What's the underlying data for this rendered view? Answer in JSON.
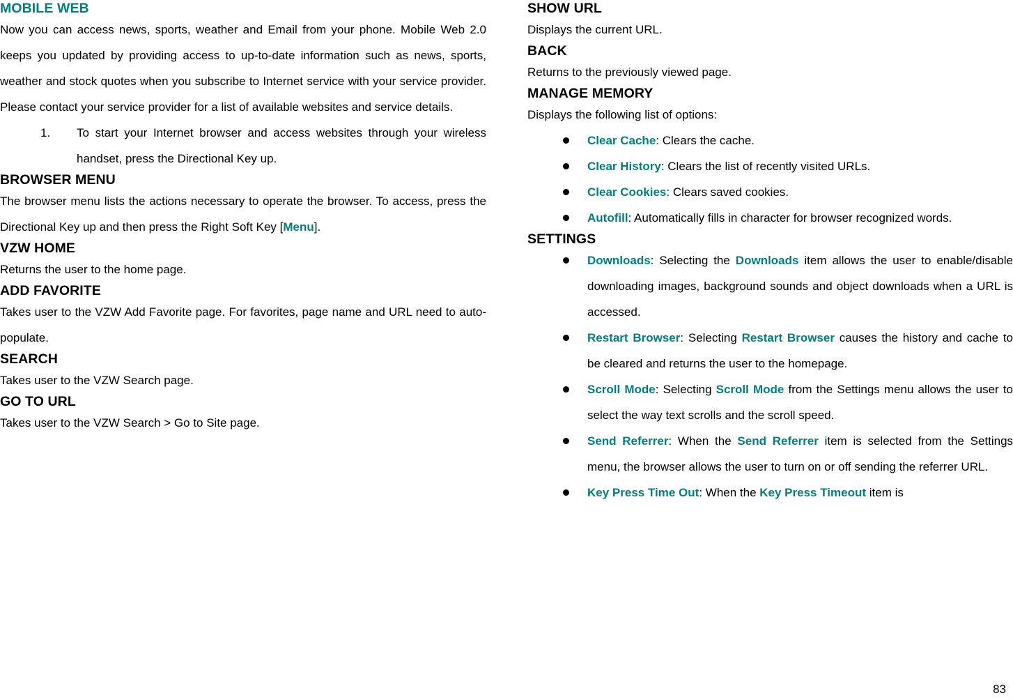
{
  "accent_color": "#017f7f",
  "page_number": "83",
  "left_column": {
    "sections": [
      {
        "heading": "MOBILE WEB",
        "heading_color": "teal",
        "paragraphs": [
          "Now you can access news, sports, weather and Email from your phone. Mobile Web 2.0 keeps you updated by providing access to up-to-date information such as news, sports, weather and stock quotes when you subscribe to Internet service with your service provider. Please contact your service provider for a list of available websites and service details."
        ],
        "numbered_items": [
          {
            "number": "1.",
            "text": "To start your Internet browser and access websites through your wireless handset, press the Directional Key up."
          }
        ]
      },
      {
        "heading": "BROWSER MENU",
        "heading_color": "black",
        "paragraph_parts": {
          "before": "The browser menu lists the actions necessary to operate the browser. To access, press the Directional Key up and then press the Right Soft Key [",
          "keyword": "Menu",
          "after": "]."
        }
      },
      {
        "heading": "VZW HOME",
        "heading_color": "black",
        "paragraphs": [
          "Returns the user to the home page."
        ]
      },
      {
        "heading": "ADD FAVORITE",
        "heading_color": "black",
        "paragraphs": [
          "Takes user to the VZW Add Favorite page. For favorites, page name and URL need to auto-populate."
        ]
      },
      {
        "heading": "SEARCH",
        "heading_color": "black",
        "paragraphs": [
          "Takes user to the VZW Search page."
        ]
      },
      {
        "heading": "GO TO URL",
        "heading_color": "black",
        "paragraphs": [
          "Takes user to the VZW Search > Go to Site page."
        ]
      }
    ]
  },
  "right_column": {
    "sections": [
      {
        "heading": "SHOW URL",
        "paragraphs": [
          "Displays the current URL."
        ]
      },
      {
        "heading": "BACK",
        "paragraphs": [
          "Returns to the previously viewed page."
        ]
      },
      {
        "heading": "MANAGE MEMORY",
        "paragraphs": [
          "Displays the following list of options:"
        ],
        "bullets": [
          {
            "keyword": "Clear Cache",
            "text": ": Clears the cache."
          },
          {
            "keyword": "Clear History",
            "text": ": Clears the list of recently visited URLs."
          },
          {
            "keyword": "Clear Cookies",
            "text": ": Clears saved cookies."
          },
          {
            "keyword": "Autofill",
            "text": ": Automatically fills in character for browser recognized words."
          }
        ]
      },
      {
        "heading": "SETTINGS",
        "bullets": [
          {
            "keyword": "Downloads",
            "mid1": ": Selecting the ",
            "keyword2": "Downloads",
            "mid2": " item allows the user to enable/disable downloading images, background sounds and object downloads when a URL is accessed."
          },
          {
            "keyword": "Restart Browser",
            "mid1": ": Selecting ",
            "keyword2": "Restart Browser",
            "mid2": " causes the history and cache to be cleared and returns the user to the homepage."
          },
          {
            "keyword": "Scroll Mode",
            "mid1": ": Selecting ",
            "keyword2": "Scroll Mode",
            "mid2": " from the Settings menu allows the user to select the way text scrolls and the scroll speed."
          },
          {
            "keyword": "Send Referrer",
            "mid1": ": When the ",
            "keyword2": "Send Referrer",
            "mid2": " item is selected from the Settings menu, the browser allows the user to turn on or off sending the referrer URL."
          },
          {
            "keyword": "Key Press Time Out",
            "mid1": ": When the ",
            "keyword2": "Key Press Timeout",
            "mid2": " item is"
          }
        ]
      }
    ]
  }
}
